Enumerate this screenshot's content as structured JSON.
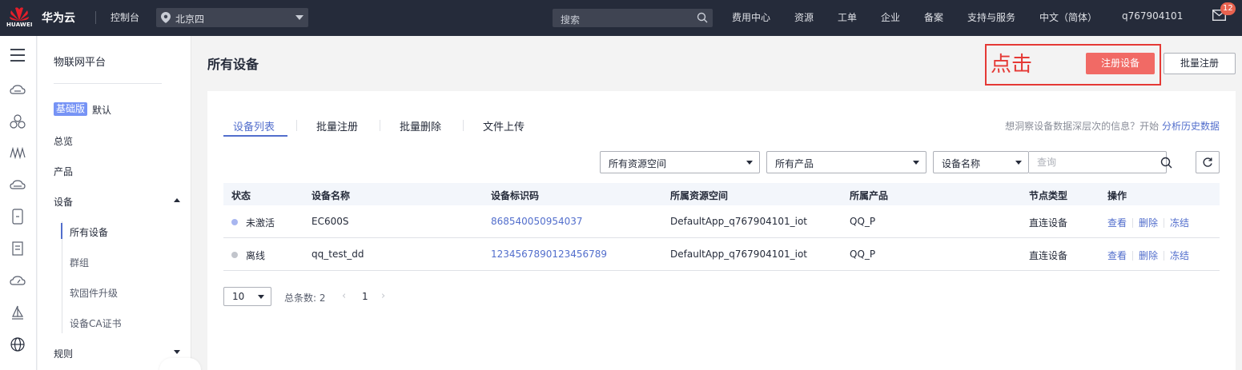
{
  "colors": {
    "topbar": "#252b3a",
    "accent": "#526ecc",
    "primary_button": "#f16a65",
    "annotation": "#e53935",
    "badge_basic": "#7693f5"
  },
  "topbar": {
    "logo_text": "HUAWEI",
    "brand": "华为云",
    "console": "控制台",
    "region": "北京四",
    "search_placeholder": "搜索",
    "nav": [
      "费用中心",
      "资源",
      "工单",
      "企业",
      "备案",
      "支持与服务",
      "中文（简体）",
      "q767904101"
    ],
    "message_count": "12"
  },
  "sidebar": {
    "title": "物联网平台",
    "edition_badge": "基础版",
    "edition": "默认",
    "items": [
      "总览",
      "产品",
      "设备",
      "规则"
    ],
    "device_sub": [
      "所有设备",
      "群组",
      "软固件升级",
      "设备CA证书"
    ]
  },
  "main": {
    "title": "所有设备",
    "annotation": "点击",
    "register_button": "注册设备",
    "batch_register_button": "批量注册"
  },
  "tabs": [
    "设备列表",
    "批量注册",
    "批量删除",
    "文件上传"
  ],
  "insight": {
    "text": "想洞察设备数据深层次的信息？开始 ",
    "link": "分析历史数据"
  },
  "filters": {
    "space": "所有资源空间",
    "product": "所有产品",
    "field": "设备名称",
    "query_placeholder": "查询"
  },
  "table": {
    "columns": [
      "状态",
      "设备名称",
      "设备标识码",
      "所属资源空间",
      "所属产品",
      "节点类型",
      "操作"
    ],
    "rows": [
      {
        "status": "未激活",
        "status_color": "#a8b6f0",
        "name": "EC600S",
        "id": "868540050954037",
        "space": "DefaultApp_q767904101_iot",
        "product": "QQ_P",
        "node": "直连设备"
      },
      {
        "status": "离线",
        "status_color": "#c2c5cc",
        "name": "qq_test_dd",
        "id": "1234567890123456789",
        "space": "DefaultApp_q767904101_iot",
        "product": "QQ_P",
        "node": "直连设备"
      }
    ],
    "actions": [
      "查看",
      "删除",
      "冻结"
    ]
  },
  "pager": {
    "size": "10",
    "total": "总条数: 2",
    "page": "1"
  }
}
